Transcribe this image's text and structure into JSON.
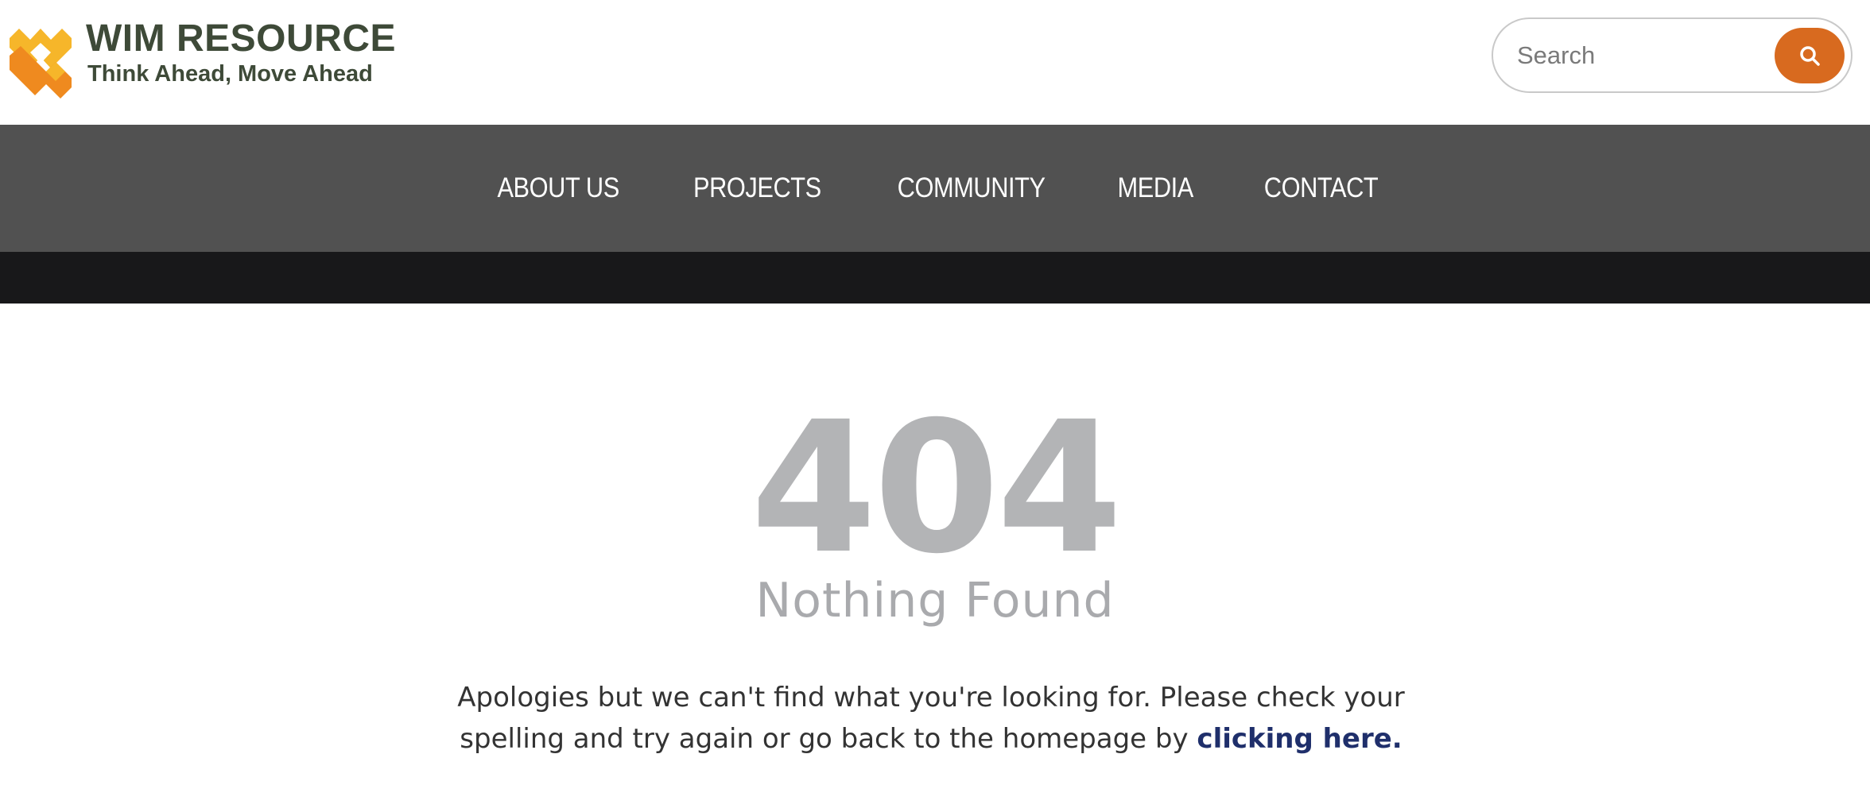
{
  "brand": {
    "name": "WIM RESOURCE",
    "tagline": "Think Ahead, Move Ahead",
    "colors": {
      "dark_green": "#3e4a38",
      "gold": "#f6b62a",
      "orange": "#ef8a1f"
    }
  },
  "search": {
    "placeholder": "Search",
    "button_icon": "search-icon",
    "button_color": "#d86a1f"
  },
  "nav": {
    "items": [
      {
        "label": "ABOUT US"
      },
      {
        "label": "PROJECTS"
      },
      {
        "label": "COMMUNITY"
      },
      {
        "label": "MEDIA"
      },
      {
        "label": "CONTACT"
      }
    ],
    "background": "#515151"
  },
  "error": {
    "code": "404",
    "title": "Nothing Found",
    "message": "Apologies but we can't find what you're looking for. Please check your spelling and try again or go back to the homepage by ",
    "link_text": "clicking here."
  }
}
